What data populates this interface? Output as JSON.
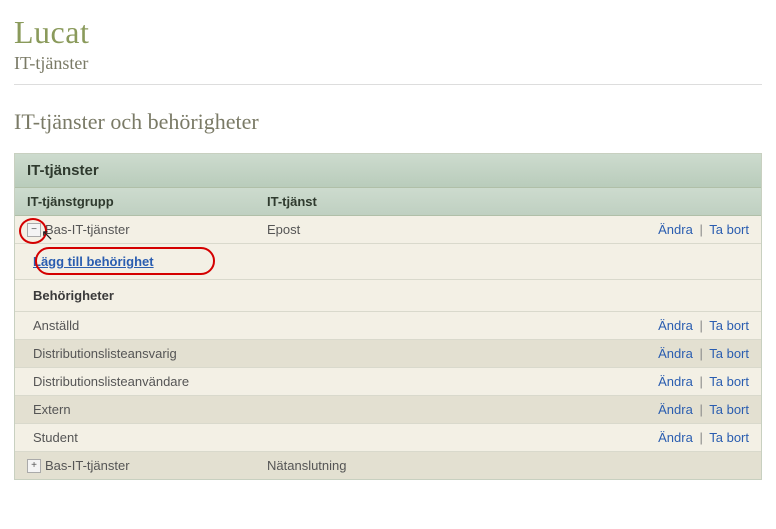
{
  "app": {
    "title": "Lucat",
    "subtitle": "IT-tjänster"
  },
  "section_heading": "IT-tjänster och behörigheter",
  "panel": {
    "title": "IT-tjänster",
    "columns": {
      "group": "IT-tjänstgrupp",
      "service": "IT-tjänst"
    }
  },
  "row_open": {
    "group": "Bas-IT-tjänster",
    "service": "Epost",
    "actions": {
      "edit": "Ändra",
      "delete": "Ta bort"
    },
    "add_link": "Lägg till behörighet",
    "sub_header": "Behörigheter",
    "permissions": [
      {
        "name": "Anställd"
      },
      {
        "name": "Distributionslisteansvarig"
      },
      {
        "name": "Distributionslisteanvändare"
      },
      {
        "name": "Extern"
      },
      {
        "name": "Student"
      }
    ]
  },
  "row_collapsed": {
    "group": "Bas-IT-tjänster",
    "service": "Nätanslutning"
  },
  "action_labels": {
    "edit": "Ändra",
    "delete": "Ta bort"
  }
}
